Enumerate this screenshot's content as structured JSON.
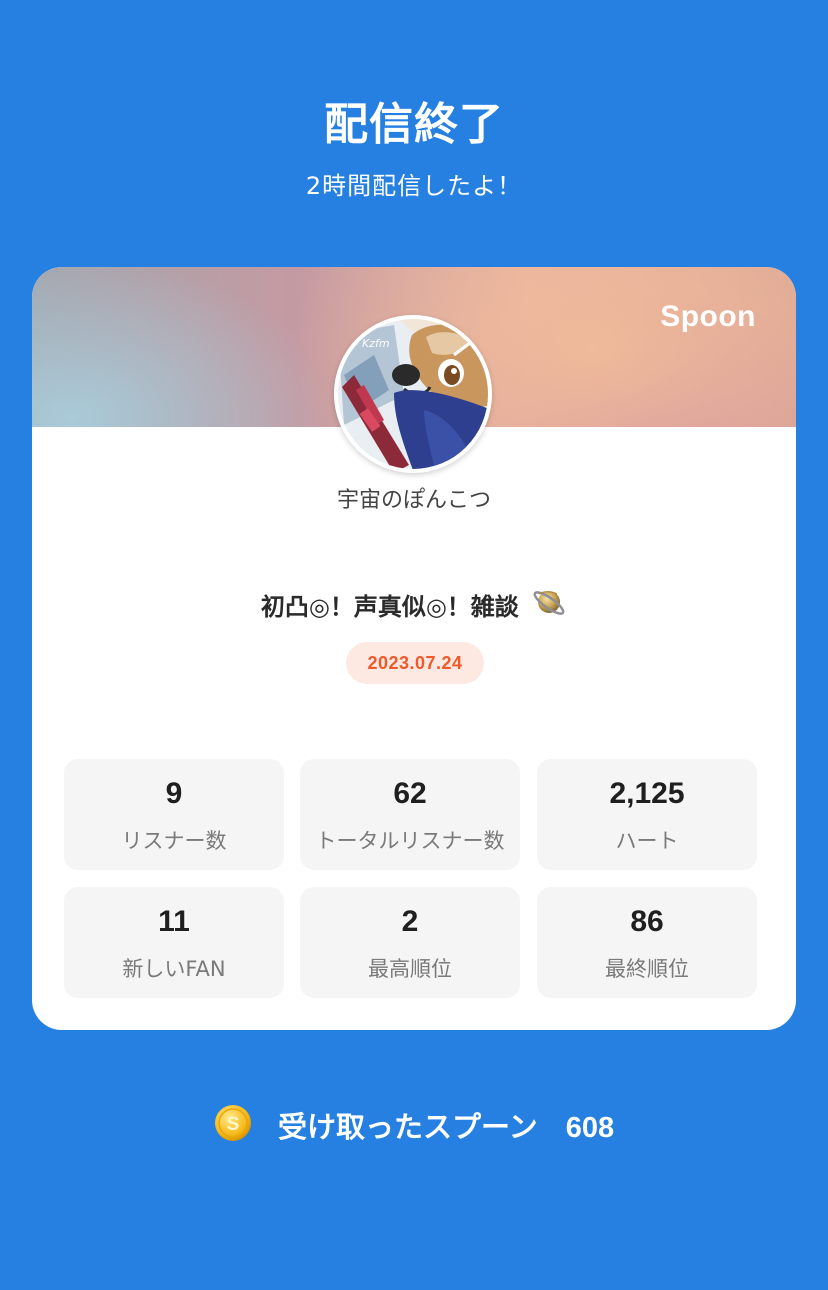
{
  "header": {
    "title": "配信終了",
    "subtitle": "2時間配信したよ！"
  },
  "card": {
    "brand": "Spoon",
    "username": "宇宙のぽんこつ",
    "live_title": "初凸◎！声真似◎！雑談",
    "title_emoji_icon": "ringed-planet-icon",
    "date": "2023.07.24",
    "stats": [
      {
        "value": "9",
        "label": "リスナー数"
      },
      {
        "value": "62",
        "label": "トータルリスナー数"
      },
      {
        "value": "2,125",
        "label": "ハート"
      },
      {
        "value": "11",
        "label": "新しいFAN"
      },
      {
        "value": "2",
        "label": "最高順位"
      },
      {
        "value": "86",
        "label": "最終順位"
      }
    ]
  },
  "footer": {
    "coin_icon": "spoon-coin-icon",
    "received_label": "受け取ったスプーン",
    "received_count": "608"
  },
  "colors": {
    "background": "#2680E2",
    "card": "#FFFFFF",
    "date_badge_bg": "#FDE9E2",
    "date_badge_text": "#F05A2A",
    "stat_bg": "#F5F5F5"
  }
}
